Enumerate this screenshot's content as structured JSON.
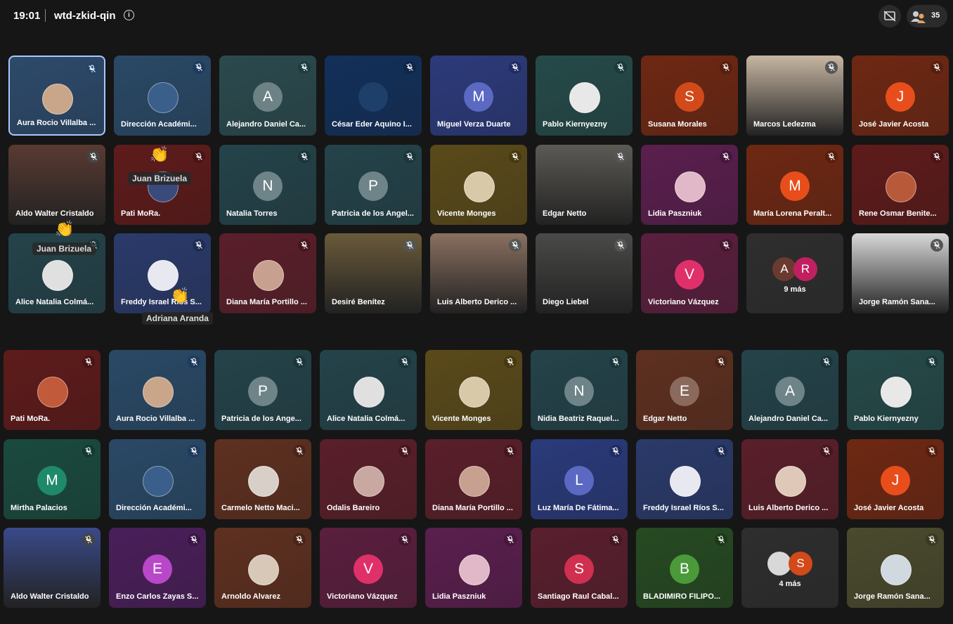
{
  "meeting": {
    "time": "19:01",
    "code": "wtd-zkid-qin",
    "participant_count": "35"
  },
  "icons": {
    "info": "info-icon",
    "present": "present-off-icon",
    "people": "people-icon",
    "mic": "mic-off-icon",
    "hand": "raised-hand-icon"
  },
  "reactions": [
    {
      "name": "Juan Brizuela"
    },
    {
      "name": "Juan Brizuela"
    },
    {
      "name": "Adriana Aranda"
    }
  ],
  "grid_top": [
    {
      "name": "Aura Rocio Villalba ...",
      "initial": "",
      "color": "#2d4a6a",
      "mic": "#23456b",
      "photo": "#c9a58a"
    },
    {
      "name": "Dirección Académi...",
      "initial": "",
      "color": "#2a4966",
      "mic": "#1e3a5f",
      "photo": "#3a5f8a"
    },
    {
      "name": "Alejandro Daniel Ca...",
      "initial": "A",
      "color": "#2b4a4e",
      "mic": "#1d3d40",
      "avatar": "#6d8285"
    },
    {
      "name": "César Eder Aquino I...",
      "initial": "",
      "color": "#13305a",
      "mic": "#0e2648",
      "avatar": "#1f3f6b"
    },
    {
      "name": "Miguel Verza Duarte",
      "initial": "M",
      "color": "#2c3a7a",
      "mic": "#202c63",
      "avatar": "#5b69c3"
    },
    {
      "name": "Pablo Kiernyezny",
      "initial": "",
      "color": "#254a49",
      "mic": "#1a3b3a",
      "photo": "#e8e8e8"
    },
    {
      "name": "Susana Morales",
      "initial": "S",
      "color": "#6e2813",
      "mic": "#561e0d",
      "avatar": "#d24a1a"
    },
    {
      "name": "Marcos Ledezma",
      "initial": "",
      "color": "#b8a28c",
      "mic": "#555",
      "video": "#c7b6a2"
    },
    {
      "name": "José Javier Acosta",
      "initial": "J",
      "color": "#6e2813",
      "mic": "#561e0d",
      "avatar": "#e84e1b"
    },
    {
      "name": "Aldo Walter Cristaldo",
      "initial": "",
      "color": "#3a3a3a",
      "mic": "#444",
      "video": "#5a3a32"
    },
    {
      "name": "Pati MoRa.",
      "initial": "",
      "color": "#5e1b1b",
      "mic": "#4a1414",
      "photo": "#3a4a7a"
    },
    {
      "name": "Natalia Torres",
      "initial": "N",
      "color": "#24434a",
      "mic": "#1a353b",
      "avatar": "#6e8488"
    },
    {
      "name": "Patricia de los Angel...",
      "initial": "P",
      "color": "#24434a",
      "mic": "#1a353b",
      "avatar": "#6e8488"
    },
    {
      "name": "Vicente Monges",
      "initial": "",
      "color": "#5a4a1a",
      "mic": "#463910",
      "photo": "#d8c9a8"
    },
    {
      "name": "Edgar Netto",
      "initial": "",
      "color": "#3a3a3a",
      "mic": "#555",
      "video": "#5c5a55"
    },
    {
      "name": "Lidia Paszniuk",
      "initial": "",
      "color": "#5a1f4e",
      "mic": "#46163c",
      "photo": "#e0b8c8"
    },
    {
      "name": "María Lorena Peralt...",
      "initial": "M",
      "color": "#6e2813",
      "mic": "#561e0d",
      "avatar": "#e84e1b"
    },
    {
      "name": "Rene Osmar Benite...",
      "initial": "",
      "color": "#5e1b1b",
      "mic": "#4a1414",
      "photo": "#b85a3a"
    },
    {
      "name": "Alice Natalia Colmá...",
      "initial": "",
      "color": "#24434a",
      "mic": "#1a353b",
      "photo": "#e0e0e0"
    },
    {
      "name": "Freddy Israel Ríos S...",
      "initial": "",
      "color": "#2a3a6a",
      "mic": "#1e2c55",
      "photo": "#e8e8f0"
    },
    {
      "name": "Diana María Portillo ...",
      "initial": "",
      "color": "#5a1f2a",
      "mic": "#46161f",
      "photo": "#c8a090"
    },
    {
      "name": "Desiré Benítez",
      "initial": "",
      "color": "#3a3a3a",
      "mic": "#555",
      "video": "#6a5a3a"
    },
    {
      "name": "Luis Alberto Derico ...",
      "initial": "",
      "color": "#3a3a3a",
      "mic": "#555",
      "video": "#8a7060"
    },
    {
      "name": "Diego Liebel",
      "initial": "",
      "color": "#3a3a3a",
      "mic": "#555",
      "video": "#4a4a48"
    },
    {
      "name": "Victoriano Vázquez",
      "initial": "V",
      "color": "#5a1f3e",
      "mic": "#46162f",
      "avatar": "#e0306a"
    },
    {
      "name": "9 más",
      "initial": "",
      "more": true,
      "a": "A",
      "b": "R",
      "color": "#2e2e2e"
    },
    {
      "name": "Jorge Ramón Sana...",
      "initial": "",
      "color": "#3a3a3a",
      "mic": "#555",
      "video": "#d8d8d8"
    }
  ],
  "grid_bottom": [
    {
      "name": "Pati MoRa.",
      "initial": "",
      "color": "#5e1b1b",
      "mic": "#4a1414",
      "photo": "#c05a3a"
    },
    {
      "name": "Aura Rocio Villalba ...",
      "initial": "",
      "color": "#2a4966",
      "mic": "#1e3a5f",
      "photo": "#c9a58a"
    },
    {
      "name": "Patricia de los Ange...",
      "initial": "P",
      "color": "#24434a",
      "mic": "#1a353b",
      "avatar": "#6e8488"
    },
    {
      "name": "Alice Natalia Colmá...",
      "initial": "",
      "color": "#24434a",
      "mic": "#1a353b",
      "photo": "#e0e0e0"
    },
    {
      "name": "Vicente Monges",
      "initial": "",
      "color": "#5a4a1a",
      "mic": "#463910",
      "photo": "#d8c9a8"
    },
    {
      "name": "Nidia Beatriz Raquel...",
      "initial": "N",
      "color": "#24434a",
      "mic": "#1a353b",
      "avatar": "#6e8488"
    },
    {
      "name": "Edgar Netto",
      "initial": "E",
      "color": "#5e3020",
      "mic": "#4a2418",
      "avatar": "#8a6a5c"
    },
    {
      "name": "Alejandro Daniel Ca...",
      "initial": "A",
      "color": "#24434a",
      "mic": "#1a353b",
      "avatar": "#6e8488"
    },
    {
      "name": "Pablo Kiernyezny",
      "initial": "",
      "color": "#254a49",
      "mic": "#1a3b3a",
      "photo": "#e8e8e8"
    },
    {
      "name": "Mirtha Palacios",
      "initial": "M",
      "color": "#1a4a3e",
      "mic": "#123a30",
      "avatar": "#1f8a6a"
    },
    {
      "name": "Dirección Académi...",
      "initial": "",
      "color": "#2a4966",
      "mic": "#1e3a5f",
      "photo": "#3a5f8a"
    },
    {
      "name": "Carmelo Netto Maci...",
      "initial": "",
      "color": "#5e3020",
      "mic": "#4a2418",
      "photo": "#d8d0c8"
    },
    {
      "name": "Odalis Bareiro",
      "initial": "",
      "color": "#5a1f2a",
      "mic": "#46161f",
      "photo": "#c8a8a0"
    },
    {
      "name": "Diana María Portillo ...",
      "initial": "",
      "color": "#5a1f2a",
      "mic": "#46161f",
      "photo": "#c8a090"
    },
    {
      "name": "Luz María De Fátima...",
      "initial": "L",
      "color": "#2a3a7a",
      "mic": "#1e2c63",
      "avatar": "#5b69c3"
    },
    {
      "name": "Freddy Israel Ríos S...",
      "initial": "",
      "color": "#2a3a6a",
      "mic": "#1e2c55",
      "photo": "#e8e8f0"
    },
    {
      "name": "Luis Alberto Derico ...",
      "initial": "",
      "color": "#5a1f2a",
      "mic": "#46161f",
      "photo": "#e0c8b8"
    },
    {
      "name": "José Javier Acosta",
      "initial": "J",
      "color": "#6e2813",
      "mic": "#561e0d",
      "avatar": "#e84e1b"
    },
    {
      "name": "Aldo Walter Cristaldo",
      "initial": "",
      "color": "#3a3a3a",
      "mic": "#444",
      "video": "#3a4a8a"
    },
    {
      "name": "Enzo Carlos Zayas S...",
      "initial": "E",
      "color": "#4a1f5a",
      "mic": "#3a1647",
      "avatar": "#b848c8"
    },
    {
      "name": "Arnoldo Alvarez",
      "initial": "",
      "color": "#5e3020",
      "mic": "#4a2418",
      "photo": "#d8c8b8"
    },
    {
      "name": "Victoriano Vázquez",
      "initial": "V",
      "color": "#5a1f3e",
      "mic": "#46162f",
      "avatar": "#e0306a"
    },
    {
      "name": "Lidia Paszniuk",
      "initial": "",
      "color": "#5a1f4e",
      "mic": "#46163c",
      "photo": "#e0b8c8"
    },
    {
      "name": "Santiago Raul Cabal...",
      "initial": "S",
      "color": "#5a1f2e",
      "mic": "#461623",
      "avatar": "#d03050"
    },
    {
      "name": "BLADIMIRO FILIPO...",
      "initial": "B",
      "color": "#264a22",
      "mic": "#1c3a18",
      "avatar": "#4a9a3a"
    },
    {
      "name": "4 más",
      "initial": "",
      "more": true,
      "a": "",
      "b": "S",
      "color": "#2e2e2e"
    },
    {
      "name": "Jorge Ramón Sana...",
      "initial": "",
      "color": "#4a4a2e",
      "mic": "#3a3a22",
      "photo": "#d0d8e0"
    }
  ]
}
